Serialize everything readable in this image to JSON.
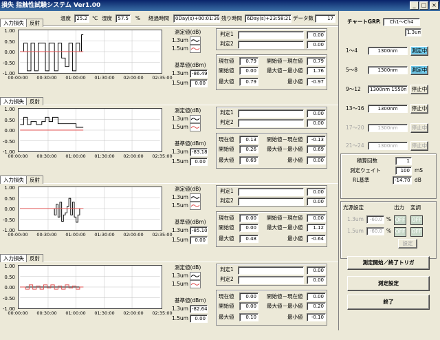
{
  "window": {
    "title": "損失 指触性試験システム Ver1.00",
    "buttons": [
      "_",
      "□",
      "×"
    ]
  },
  "status": {
    "temp_label": "温度",
    "temp_value": "25.2",
    "temp_unit": "℃",
    "hum_label": "湿度",
    "hum_value": "57.5",
    "hum_unit": "%",
    "elapsed_label": "経過時間",
    "elapsed_value": "0Day(s)+00:01:39",
    "remain_label": "残り時間",
    "remain_value": "6Day(s)+23:58:21",
    "count_label": "データ数",
    "count_value": "17"
  },
  "common": {
    "tab_insertion": "入力損失",
    "tab_reflect": "反射",
    "measure_label": "測定値(dB)",
    "wl13": "1.3um",
    "wl15": "1.5um",
    "ref_label": "基準値(dBm)",
    "judge1": "判定1",
    "judge2": "判定2",
    "cur": "現在値",
    "start": "開始値",
    "max": "最大値",
    "start_minus_cur": "開始値－現在値",
    "max_minus_min": "最大値－最小値",
    "min": "最小値",
    "yticks": [
      "1.00",
      "0.50",
      "0.00",
      "-0.50",
      "-1.00"
    ],
    "xticks": [
      "00:00:00",
      "00:30:00",
      "01:00:00",
      "01:30:00",
      "02:00:00",
      "02:35:00"
    ]
  },
  "channels": [
    {
      "ref13": "-86.49",
      "ref15": "0.00",
      "j1": "0.00",
      "j2": "0.00",
      "cur": "0.79",
      "start": "0.00",
      "max": "0.79",
      "smc": "0.79",
      "mmm": "1.76",
      "min": "-0.97"
    },
    {
      "ref13": "-83.18",
      "ref15": "0.00",
      "j1": "0.00",
      "j2": "0.00",
      "cur": "0.13",
      "start": "0.26",
      "max": "0.69",
      "smc": "-0.13",
      "mmm": "0.69",
      "min": "0.00"
    },
    {
      "ref13": "-85.10",
      "ref15": "0.00",
      "j1": "0.00",
      "j2": "0.00",
      "cur": "0.00",
      "start": "0.00",
      "max": "0.48",
      "smc": "0.00",
      "mmm": "1.12",
      "min": "-0.64"
    },
    {
      "ref13": "-82.64",
      "ref15": "0.00",
      "j1": "0.00",
      "j2": "0.00",
      "cur": "0.00",
      "start": "0.00",
      "max": "0.10",
      "smc": "0.00",
      "mmm": "0.20",
      "min": "-0.10"
    }
  ],
  "chart_data": [
    {
      "type": "line",
      "ylim": [
        -1,
        1
      ],
      "xticks": [
        "00:00:00",
        "00:30:00",
        "01:00:00",
        "01:30:00",
        "02:00:00",
        "02:35:00"
      ],
      "series": [
        {
          "name": "1.3um",
          "color": "#000000",
          "x": [
            0,
            2,
            4,
            6,
            8,
            10,
            12,
            14,
            16,
            18,
            20,
            22,
            24,
            26,
            28,
            30,
            32,
            34,
            36,
            38,
            40,
            42,
            44,
            46,
            48,
            50,
            52,
            54,
            56,
            58,
            60,
            62,
            64,
            66,
            68,
            70
          ],
          "values": [
            0,
            0,
            0.4,
            0.4,
            -0.9,
            -0.9,
            0.4,
            0.4,
            -0.9,
            -0.9,
            0.4,
            0.4,
            0.4,
            0.4,
            -0.9,
            -0.9,
            0.4,
            0.4,
            0.4,
            -0.9,
            -0.9,
            0.4,
            0.4,
            -0.3,
            -0.3,
            -0.7,
            -0.7,
            0.4,
            0.4,
            -0.9,
            -0.9,
            0.4,
            0.4,
            0,
            0.79,
            0.79
          ]
        },
        {
          "name": "1.5um",
          "color": "#e05050",
          "x": [
            0,
            70
          ],
          "values": [
            0,
            0
          ]
        }
      ]
    },
    {
      "type": "line",
      "ylim": [
        -1,
        1
      ],
      "xticks": [
        "00:00:00",
        "00:30:00",
        "01:00:00",
        "01:30:00",
        "02:00:00",
        "02:35:00"
      ],
      "series": [
        {
          "name": "1.3um",
          "color": "#000000",
          "x": [
            0,
            4,
            6,
            8,
            10,
            12,
            16,
            18,
            20,
            24,
            26,
            28,
            30,
            32,
            34,
            36,
            40,
            42,
            46,
            50,
            54,
            58,
            62,
            66,
            70
          ],
          "values": [
            0.26,
            0.6,
            0.6,
            0.26,
            0.26,
            0.4,
            0.4,
            0.26,
            0.26,
            0.4,
            0.4,
            0.6,
            0.6,
            0.4,
            0.4,
            0.6,
            0.6,
            0.3,
            0.3,
            0.3,
            0.3,
            0.3,
            0.13,
            0.13,
            0.13
          ]
        },
        {
          "name": "1.5um",
          "color": "#e05050",
          "x": [
            0,
            70
          ],
          "values": [
            0,
            0
          ]
        }
      ]
    },
    {
      "type": "line",
      "ylim": [
        -1,
        1
      ],
      "xticks": [
        "00:00:00",
        "00:30:00",
        "01:00:00",
        "01:30:00",
        "02:00:00",
        "02:35:00"
      ],
      "series": [
        {
          "name": "1.3um",
          "color": "#000000",
          "x": [
            0,
            36,
            38,
            40,
            42,
            44,
            46,
            48,
            50,
            52,
            54,
            56,
            58,
            60,
            62,
            64,
            66,
            70
          ],
          "values": [
            0,
            0,
            -0.3,
            0.2,
            -0.4,
            0.3,
            -0.6,
            -0.3,
            -0.2,
            0.1,
            0.48,
            -0.3,
            0.3,
            -0.4,
            -0.64,
            -0.3,
            0,
            0
          ]
        },
        {
          "name": "1.5um",
          "color": "#e05050",
          "x": [
            0,
            70
          ],
          "values": [
            0,
            0
          ]
        }
      ]
    },
    {
      "type": "line",
      "ylim": [
        -1,
        1
      ],
      "xticks": [
        "00:00:00",
        "00:30:00",
        "01:00:00",
        "01:30:00",
        "02:00:00",
        "02:35:00"
      ],
      "series": [
        {
          "name": "1.3um",
          "color": "#000000",
          "x": [
            0,
            70
          ],
          "values": [
            0,
            0
          ]
        },
        {
          "name": "1.5um",
          "color": "#e05050",
          "x": [
            0,
            6,
            10,
            14,
            18,
            22,
            26,
            30,
            34,
            38,
            42,
            46,
            50,
            54,
            58,
            62,
            66,
            70
          ],
          "values": [
            0,
            -0.1,
            0.1,
            -0.1,
            0.05,
            -0.1,
            0.1,
            -0.05,
            0.1,
            -0.1,
            0.05,
            -0.1,
            0.1,
            -0.05,
            0.05,
            -0.1,
            0,
            0
          ]
        }
      ]
    }
  ],
  "right": {
    "chart_grp_label": "チャートGRP.",
    "chart_grp_value": "Ch1～Ch4",
    "wl_value": "1.3um",
    "groups": [
      {
        "label": "1～4",
        "value": "1300nm",
        "state": "測定中",
        "active": true,
        "enabled": true
      },
      {
        "label": "5～8",
        "value": "1300nm",
        "state": "測定中",
        "active": true,
        "enabled": true
      },
      {
        "label": "9～12",
        "value": "1300nm 1550nm",
        "state": "停止中",
        "active": false,
        "enabled": true
      },
      {
        "label": "13～16",
        "value": "1300nm",
        "state": "停止中",
        "active": false,
        "enabled": true
      },
      {
        "label": "17～20",
        "value": "1300nm",
        "state": "停止中",
        "active": false,
        "enabled": false
      },
      {
        "label": "21～24",
        "value": "1300nm",
        "state": "停止中",
        "active": false,
        "enabled": false
      }
    ],
    "integ_label": "積算回数",
    "integ_value": "1",
    "wait_label": "測定ウェイト",
    "wait_value": "100",
    "wait_unit": "mS",
    "rl_label": "RL基準",
    "rl_value": "-14.70",
    "rl_unit": "dB",
    "light_label": "光源設定",
    "out_label": "出力",
    "mod_label": "変調",
    "ls13_label": "1.3um",
    "ls13_value": "-60.0",
    "ls15_label": "1.5um",
    "ls15_value": "-60.0",
    "pct": "%",
    "off": "OFF",
    "set_btn": "設定",
    "trigger_btn": "測定開始／終了トリガ",
    "settings_btn": "測定設定",
    "exit_btn": "終了"
  }
}
